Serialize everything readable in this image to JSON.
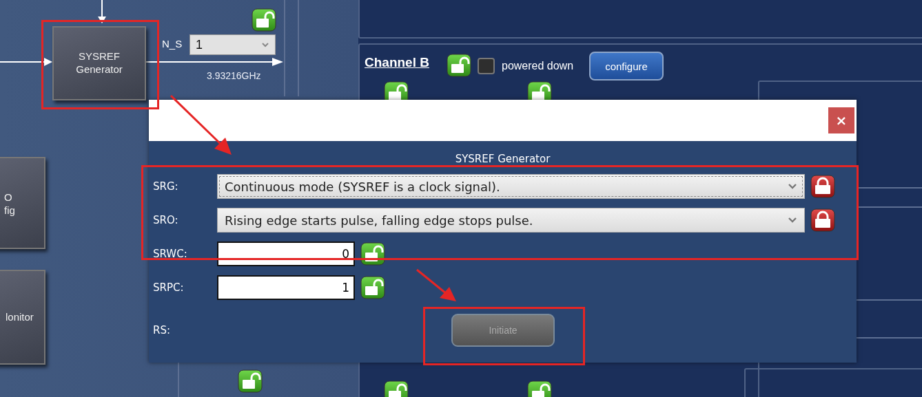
{
  "diagram": {
    "block": {
      "label": "SYSREF Generator"
    },
    "divider": {
      "label": "N_S",
      "value": "1",
      "locked": false
    },
    "output_frequency": "3.93216GHz",
    "side_blocks": [
      {
        "label": "O\nfig"
      },
      {
        "label": "lonitor"
      }
    ]
  },
  "channel_b": {
    "title": "Channel B",
    "locked": false,
    "powered_down": {
      "label": "powered down",
      "checked": false
    },
    "configure_button": "configure"
  },
  "dialog": {
    "close": "×",
    "title": "SYSREF Generator",
    "fields": [
      {
        "kind": "select",
        "label": "SRG:",
        "value": "Continuous mode (SYSREF is a clock signal).",
        "locked": true
      },
      {
        "kind": "select",
        "label": "SRO:",
        "value": "Rising edge starts pulse, falling edge stops pulse.",
        "locked": true
      },
      {
        "kind": "input",
        "label": "SRWC:",
        "value": "0",
        "locked": false
      },
      {
        "kind": "input",
        "label": "SRPC:",
        "value": "1",
        "locked": false
      },
      {
        "kind": "button",
        "label": "RS:",
        "button": "Initiate",
        "disabled": true
      }
    ]
  }
}
